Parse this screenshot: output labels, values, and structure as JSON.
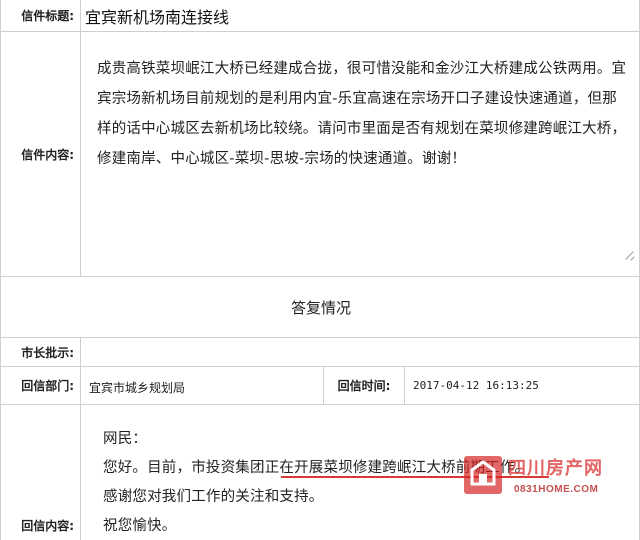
{
  "letter": {
    "title_label": "信件标题:",
    "title_value": "宜宾新机场南连接线",
    "content_label": "信件内容:",
    "content_value": "成贵高铁菜坝岷江大桥已经建成合拢，很可惜没能和金沙江大桥建成公铁两用。宜宾宗场新机场目前规划的是利用内宜-乐宜高速在宗场开口子建设快速通道，但那样的话中心城区去新机场比较绕。请问市里面是否有规划在菜坝修建跨岷江大桥，修建南岸、中心城区-菜坝-思坡-宗场的快速通道。谢谢！"
  },
  "reply": {
    "heading": "答复情况",
    "mayor_label": "市长批示:",
    "mayor_value": "",
    "dept_label": "回信部门:",
    "dept_value": "宜宾市城乡规划局",
    "time_label": "回信时间:",
    "time_value": "2017-04-12 16:13:25",
    "content_label": "回信内容:",
    "lines": [
      "网民：",
      "您好。目前，市投资集团正在开展菜坝修建跨岷江大桥前期工作。",
      "感谢您对我们工作的关注和支持。",
      "祝您愉快。"
    ]
  },
  "watermark": {
    "text": "四川房产网",
    "url": "0831HOME.COM",
    "color": "#d62828"
  },
  "colors": {
    "border": "#cfcfcf",
    "underline": "#d83a35"
  }
}
